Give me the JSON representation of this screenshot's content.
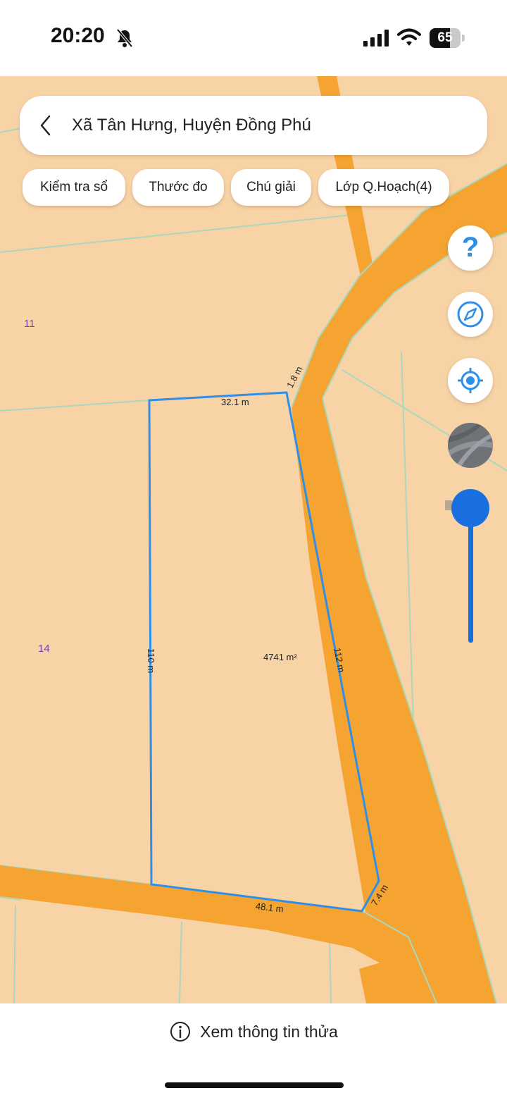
{
  "status_bar": {
    "time": "20:20",
    "battery_percent": 65,
    "battery_text": "65"
  },
  "search": {
    "title": "Xã Tân Hưng, Huyện Đồng Phú"
  },
  "chips": [
    {
      "label": "Kiểm tra sổ"
    },
    {
      "label": "Thước đo"
    },
    {
      "label": "Chú giải"
    },
    {
      "label": "Lớp Q.Hoạch(4)"
    }
  ],
  "map": {
    "neighbor_parcels": [
      "11",
      "14"
    ],
    "selected_parcel": {
      "area": "4741 m²",
      "edges": {
        "top": "32.1 m",
        "top_right": "1.8 m",
        "right": "112 m",
        "bottom_right": "7.4 m",
        "bottom": "48.1 m",
        "left": "110 m"
      }
    },
    "colors": {
      "land": "#f8d3a6",
      "road": "#f5a431",
      "parcel_outline": "#2f8ee6",
      "parcel_lines": "#a9d8c0"
    }
  },
  "controls": {
    "help": "question-icon",
    "compass": "compass-icon",
    "locate": "locate-icon",
    "layer": "satellite-layer-icon",
    "zoom_level": 1.0
  },
  "bottom": {
    "info_label": "Xem thông tin thửa"
  }
}
